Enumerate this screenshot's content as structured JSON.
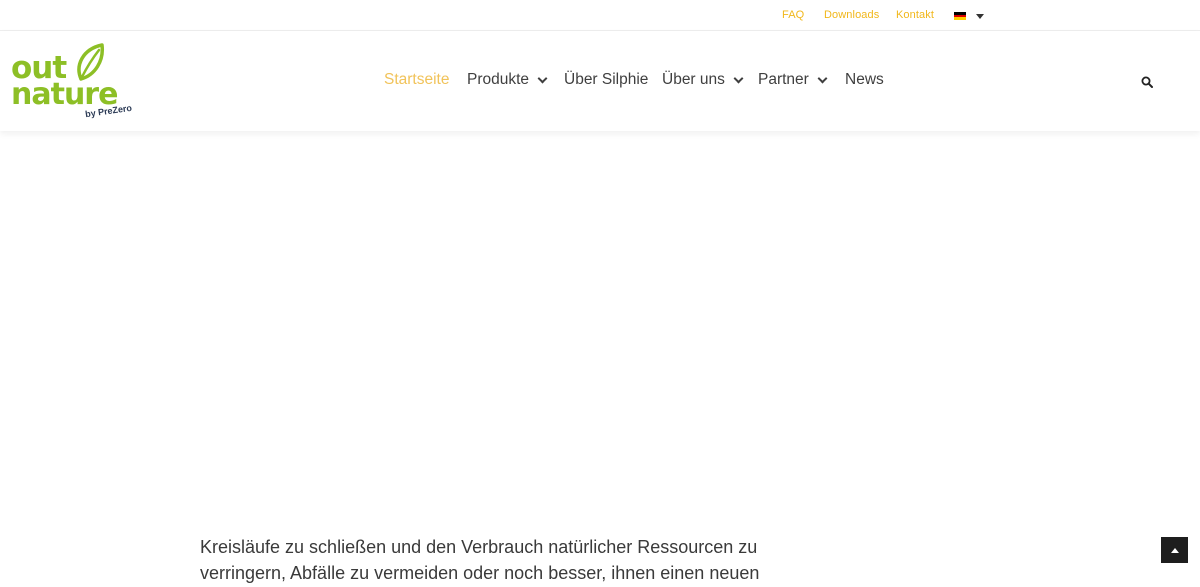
{
  "topbar": {
    "links": [
      "FAQ",
      "Downloads",
      "Kontakt"
    ],
    "language": {
      "flag_colors": [
        "#000000",
        "#dd0000",
        "#ffce00"
      ]
    }
  },
  "logo": {
    "line1": "out",
    "line2": "nature",
    "tagline": "by PreZero"
  },
  "nav": {
    "items": [
      "Startseite",
      "Produkte",
      "Über Silphie",
      "Über uns",
      "Partner",
      "News"
    ],
    "active": "Startseite"
  },
  "content": {
    "intro": "Kreisläufe zu schließen und den Verbrauch natürlicher Ressourcen zu verringern, Abfälle zu vermeiden oder noch besser, ihnen einen neuen Wert zu"
  },
  "colors": {
    "accent": "#f1b71b",
    "brand_green": "#8dbf26",
    "text": "#3a3a3a"
  },
  "icons": {
    "search": "search-icon",
    "back_to_top": "arrow-up-icon",
    "language": "flag-de-icon"
  }
}
